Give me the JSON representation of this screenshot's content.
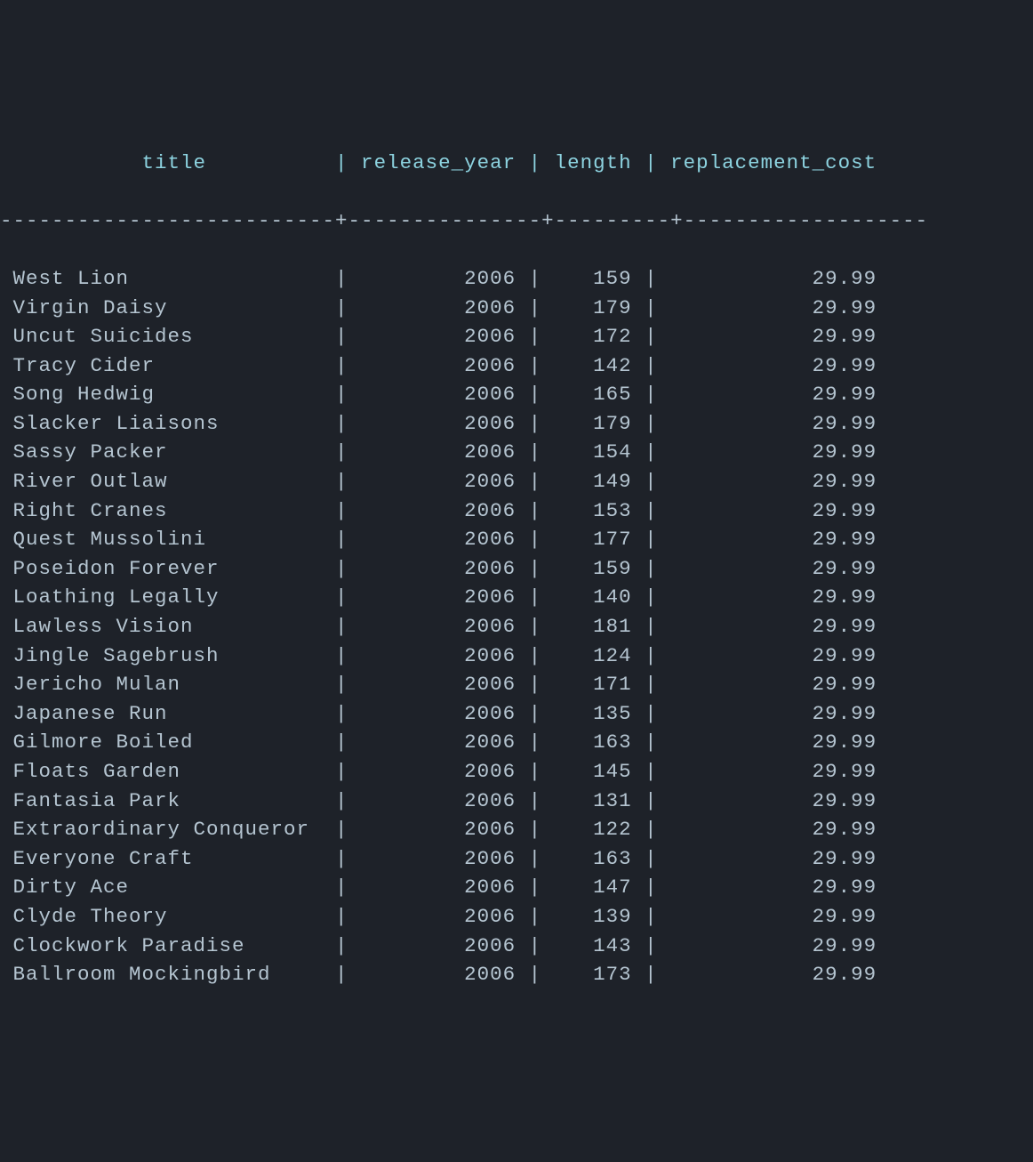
{
  "columns": {
    "title": "title",
    "release_year": "release_year",
    "length": "length",
    "replacement_cost": "replacement_cost"
  },
  "rows": [
    {
      "title": "West Lion",
      "release_year": "2006",
      "length": "159",
      "replacement_cost": "29.99"
    },
    {
      "title": "Virgin Daisy",
      "release_year": "2006",
      "length": "179",
      "replacement_cost": "29.99"
    },
    {
      "title": "Uncut Suicides",
      "release_year": "2006",
      "length": "172",
      "replacement_cost": "29.99"
    },
    {
      "title": "Tracy Cider",
      "release_year": "2006",
      "length": "142",
      "replacement_cost": "29.99"
    },
    {
      "title": "Song Hedwig",
      "release_year": "2006",
      "length": "165",
      "replacement_cost": "29.99"
    },
    {
      "title": "Slacker Liaisons",
      "release_year": "2006",
      "length": "179",
      "replacement_cost": "29.99"
    },
    {
      "title": "Sassy Packer",
      "release_year": "2006",
      "length": "154",
      "replacement_cost": "29.99"
    },
    {
      "title": "River Outlaw",
      "release_year": "2006",
      "length": "149",
      "replacement_cost": "29.99"
    },
    {
      "title": "Right Cranes",
      "release_year": "2006",
      "length": "153",
      "replacement_cost": "29.99"
    },
    {
      "title": "Quest Mussolini",
      "release_year": "2006",
      "length": "177",
      "replacement_cost": "29.99"
    },
    {
      "title": "Poseidon Forever",
      "release_year": "2006",
      "length": "159",
      "replacement_cost": "29.99"
    },
    {
      "title": "Loathing Legally",
      "release_year": "2006",
      "length": "140",
      "replacement_cost": "29.99"
    },
    {
      "title": "Lawless Vision",
      "release_year": "2006",
      "length": "181",
      "replacement_cost": "29.99"
    },
    {
      "title": "Jingle Sagebrush",
      "release_year": "2006",
      "length": "124",
      "replacement_cost": "29.99"
    },
    {
      "title": "Jericho Mulan",
      "release_year": "2006",
      "length": "171",
      "replacement_cost": "29.99"
    },
    {
      "title": "Japanese Run",
      "release_year": "2006",
      "length": "135",
      "replacement_cost": "29.99"
    },
    {
      "title": "Gilmore Boiled",
      "release_year": "2006",
      "length": "163",
      "replacement_cost": "29.99"
    },
    {
      "title": "Floats Garden",
      "release_year": "2006",
      "length": "145",
      "replacement_cost": "29.99"
    },
    {
      "title": "Fantasia Park",
      "release_year": "2006",
      "length": "131",
      "replacement_cost": "29.99"
    },
    {
      "title": "Extraordinary Conqueror",
      "release_year": "2006",
      "length": "122",
      "replacement_cost": "29.99"
    },
    {
      "title": "Everyone Craft",
      "release_year": "2006",
      "length": "163",
      "replacement_cost": "29.99"
    },
    {
      "title": "Dirty Ace",
      "release_year": "2006",
      "length": "147",
      "replacement_cost": "29.99"
    },
    {
      "title": "Clyde Theory",
      "release_year": "2006",
      "length": "139",
      "replacement_cost": "29.99"
    },
    {
      "title": "Clockwork Paradise",
      "release_year": "2006",
      "length": "143",
      "replacement_cost": "29.99"
    },
    {
      "title": "Ballroom Mockingbird",
      "release_year": "2006",
      "length": "173",
      "replacement_cost": "29.99"
    }
  ],
  "widths": {
    "title": 25,
    "release_year": 13,
    "length": 7,
    "replacement_cost": 17
  }
}
